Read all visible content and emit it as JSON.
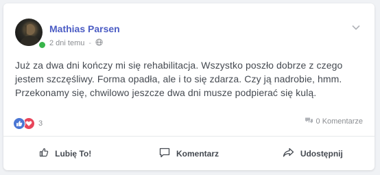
{
  "post": {
    "author": "Mathias Parsen",
    "time": "2 dni temu",
    "separator": "-",
    "privacy_icon": "globe-icon",
    "text": "Już za dwa dni kończy mi się rehabilitacja. Wszystko poszło dobrze z czego jestem szczęśliwy. Forma opadła, ale i to się zdarza. Czy ją nadrobie, hmm. Przekonamy się, chwilowo jeszcze dwa dni musze podpierać się kulą.",
    "online": true
  },
  "stats": {
    "reactions_count": "3",
    "reaction_icons": [
      "thumbs-up-icon",
      "heart-icon"
    ],
    "comments_label": "0 Komentarze"
  },
  "actions": {
    "like_label": "Lubię To!",
    "comment_label": "Komentarz",
    "share_label": "Udostępnij"
  },
  "colors": {
    "author": "#4b5cc4",
    "like_reaction": "#4a76d4",
    "love_reaction": "#e8455a",
    "online": "#39b54a"
  }
}
